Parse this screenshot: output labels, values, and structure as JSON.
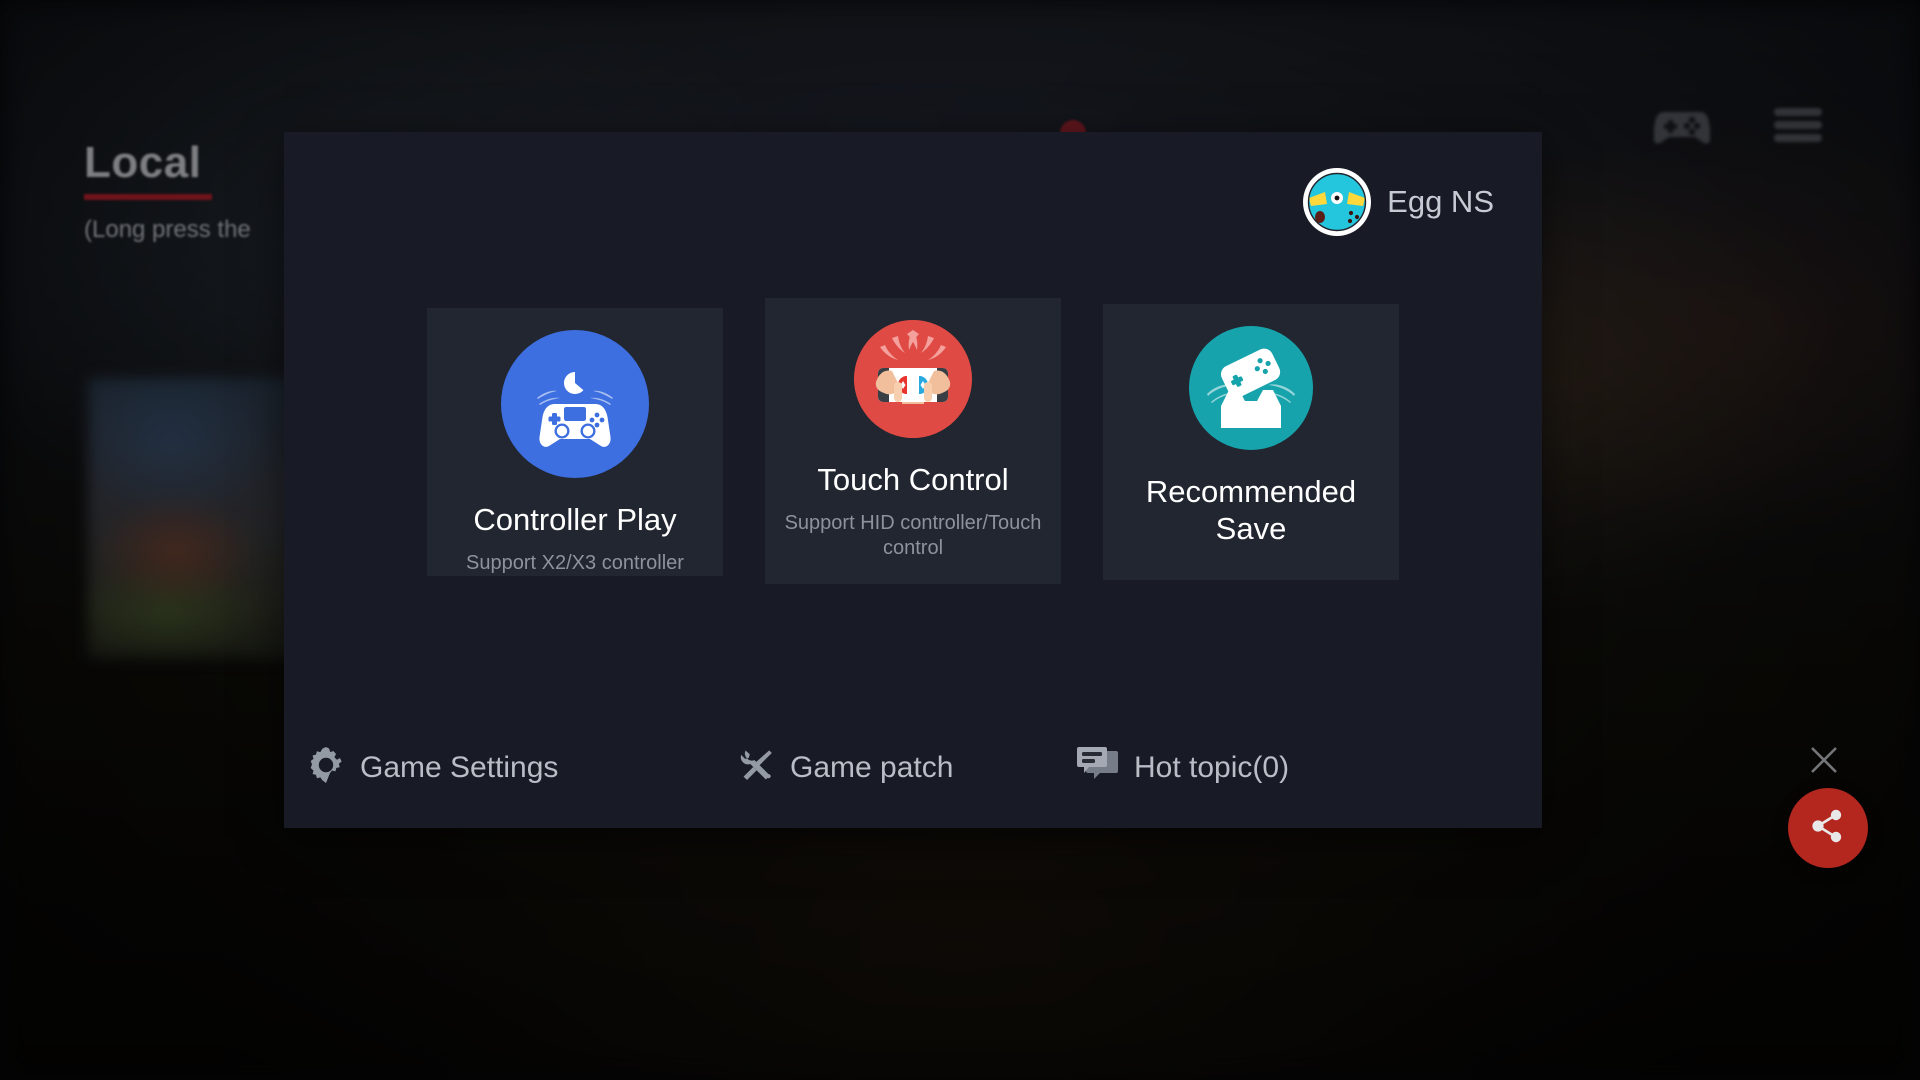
{
  "background": {
    "page_title": "Local",
    "page_subtitle": "(Long press the",
    "accent_underline_color": "#b3202c",
    "top_icons": [
      {
        "name": "gamepad-icon",
        "label": "gamepad"
      },
      {
        "name": "menu-icon",
        "label": "menu"
      }
    ]
  },
  "modal": {
    "background_color": "#181b25",
    "account": {
      "name": "Egg NS",
      "avatar_alt": "egg-ns-bird-avatar"
    },
    "cards": [
      {
        "id": "controller-play",
        "title": "Controller Play",
        "subtitle": "Support X2/X3 controller",
        "icon_name": "controller-play-icon",
        "icon_bg": "#3d6fe0",
        "card_bg": "#222630"
      },
      {
        "id": "touch-control",
        "title": "Touch Control",
        "subtitle": "Support HID controller/Touch control",
        "icon_name": "touch-control-icon",
        "icon_bg": "#e04a44",
        "card_bg": "#222630"
      },
      {
        "id": "recommended-save",
        "title": "Recommended Save",
        "subtitle": "",
        "icon_name": "recommended-save-icon",
        "icon_bg": "#16a3ac",
        "card_bg": "#222630"
      }
    ],
    "toolbar": [
      {
        "id": "game-settings",
        "label": "Game Settings",
        "icon_name": "gear-icon"
      },
      {
        "id": "game-patch",
        "label": "Game patch",
        "icon_name": "wrench-screwdriver-icon"
      },
      {
        "id": "hot-topic",
        "label": "Hot topic(0)",
        "icon_name": "chat-bubbles-icon"
      }
    ]
  },
  "floating": {
    "close_icon_name": "close-icon",
    "share_icon_name": "share-icon",
    "share_button_color": "#b3271f"
  }
}
